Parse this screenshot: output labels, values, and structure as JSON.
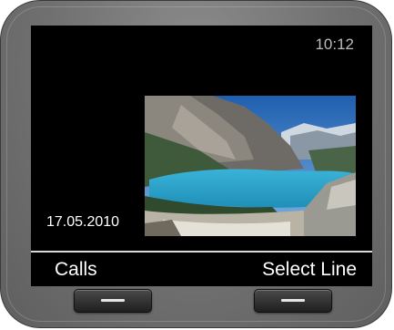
{
  "status_bar": {
    "time": "10:12"
  },
  "screensaver": {
    "date": "17.05.2010",
    "image": "mountain-lake-photo"
  },
  "softkeys": {
    "left_label": "Calls",
    "right_label": "Select Line"
  },
  "hardware": {
    "left_button_icon": "dash-icon",
    "right_button_icon": "dash-icon"
  },
  "colors": {
    "screen_background": "#000000",
    "bezel": "#707070",
    "text": "#ffffff",
    "clock_text": "#bdbdbd"
  }
}
